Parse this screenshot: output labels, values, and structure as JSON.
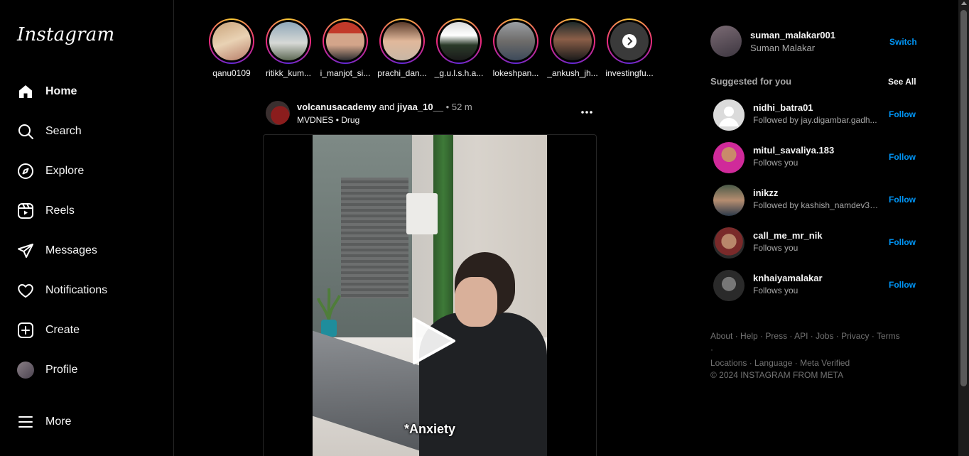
{
  "brand": {
    "logo_text": "Instagram"
  },
  "nav": [
    {
      "label": "Home",
      "icon": "home-icon"
    },
    {
      "label": "Search",
      "icon": "search-icon"
    },
    {
      "label": "Explore",
      "icon": "compass-icon"
    },
    {
      "label": "Reels",
      "icon": "reels-icon"
    },
    {
      "label": "Messages",
      "icon": "paper-plane-icon"
    },
    {
      "label": "Notifications",
      "icon": "heart-icon"
    },
    {
      "label": "Create",
      "icon": "plus-square-icon"
    },
    {
      "label": "Profile",
      "icon": "avatar"
    },
    {
      "label": "More",
      "icon": "hamburger-icon"
    }
  ],
  "stories": [
    {
      "name": "qanu0109"
    },
    {
      "name": "ritikk_kum..."
    },
    {
      "name": "i_manjot_si..."
    },
    {
      "name": "prachi_dan..."
    },
    {
      "name": "_g.u.l.s.h.a..."
    },
    {
      "name": "lokeshpan..."
    },
    {
      "name": "_ankush_jh..."
    },
    {
      "name": "investingfu..."
    }
  ],
  "post": {
    "author": "volcanusacademy",
    "joiner": "and",
    "coauthor": "jiyaa_10__",
    "dot": "•",
    "time": "52 m",
    "audio_artist": "MVDNES",
    "audio_dot": "•",
    "audio_track": "Drug",
    "caption": "*Anxiety"
  },
  "account": {
    "username": "suman_malakar001",
    "full_name": "Suman Malakar",
    "switch_label": "Switch"
  },
  "suggestions": {
    "title": "Suggested for you",
    "see_all": "See All",
    "items": [
      {
        "username": "nidhi_batra01",
        "sub": "Followed by jay.digambar.gadh...",
        "action": "Follow"
      },
      {
        "username": "mitul_savaliya.183",
        "sub": "Follows you",
        "action": "Follow"
      },
      {
        "username": "inikzz",
        "sub": "Followed by kashish_namdev30 ...",
        "action": "Follow"
      },
      {
        "username": "call_me_mr_nik",
        "sub": "Follows you",
        "action": "Follow"
      },
      {
        "username": "knhaiyamalakar",
        "sub": "Follows you",
        "action": "Follow"
      }
    ]
  },
  "footer": {
    "links": [
      "About",
      "Help",
      "Press",
      "API",
      "Jobs",
      "Privacy",
      "Terms",
      "Locations",
      "Language",
      "Meta Verified"
    ],
    "separator": " · ",
    "copyright": "© 2024 INSTAGRAM FROM META"
  },
  "colors": {
    "background": "#000000",
    "link_blue": "#0095f6",
    "muted_text": "#a8a8a8",
    "footer_text": "#737373",
    "border": "#262626"
  }
}
